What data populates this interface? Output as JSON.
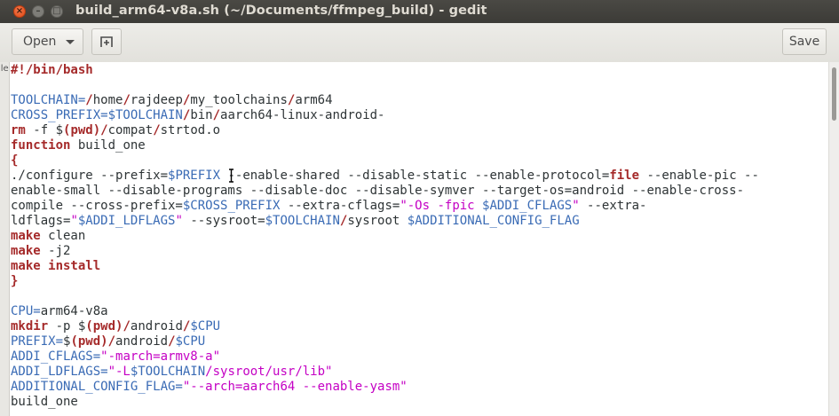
{
  "window": {
    "title": "build_arm64-v8a.sh (~/Documents/ffmpeg_build) - gedit",
    "close_glyph": "×",
    "minimize_glyph": "–",
    "maximize_glyph": "□"
  },
  "toolbar": {
    "open_label": "Open",
    "save_label": "Save",
    "new_tab_icon": "new-tab-icon"
  },
  "side_pane": {
    "text": "ile"
  },
  "colors": {
    "keyword": "#a52a2a",
    "variable": "#3a6bb5",
    "string": "#c400c4",
    "plain": "#2e3436"
  },
  "editor": {
    "lines": [
      [
        {
          "t": "#!/bin/bash",
          "c": "kw"
        }
      ],
      [],
      [
        {
          "t": "TOOLCHAIN=",
          "c": "var"
        },
        {
          "t": "/",
          "c": "kw"
        },
        {
          "t": "home"
        },
        {
          "t": "/",
          "c": "kw"
        },
        {
          "t": "rajdeep"
        },
        {
          "t": "/",
          "c": "kw"
        },
        {
          "t": "my_toolchains"
        },
        {
          "t": "/",
          "c": "kw"
        },
        {
          "t": "arm64"
        }
      ],
      [
        {
          "t": "CROSS_PREFIX=",
          "c": "var"
        },
        {
          "t": "$TOOLCHAIN",
          "c": "var"
        },
        {
          "t": "/",
          "c": "kw"
        },
        {
          "t": "bin"
        },
        {
          "t": "/",
          "c": "kw"
        },
        {
          "t": "aarch64-linux-android-"
        }
      ],
      [
        {
          "t": "rm",
          "c": "kw"
        },
        {
          "t": " -f $"
        },
        {
          "t": "(pwd)",
          "c": "kw"
        },
        {
          "t": "/",
          "c": "kw"
        },
        {
          "t": "compat"
        },
        {
          "t": "/",
          "c": "kw"
        },
        {
          "t": "strtod.o"
        }
      ],
      [
        {
          "t": "function",
          "c": "kw"
        },
        {
          "t": " build_one"
        }
      ],
      [
        {
          "t": "{",
          "c": "kw"
        }
      ],
      [
        {
          "t": "./configure --prefix="
        },
        {
          "t": "$PREFIX",
          "c": "var"
        },
        {
          "t": " --enable-shared --disable-static --enable-protocol="
        },
        {
          "t": "file",
          "c": "kw"
        },
        {
          "t": " --enable-pic --"
        }
      ],
      [
        {
          "t": "enable-small --disable-programs --disable-doc --disable-symver --target-os=android --enable-cross-"
        }
      ],
      [
        {
          "t": "compile --cross-prefix="
        },
        {
          "t": "$CROSS_PREFIX",
          "c": "var"
        },
        {
          "t": " --extra-cflags="
        },
        {
          "t": "\"-Os -fpic ",
          "c": "str"
        },
        {
          "t": "$ADDI_CFLAGS",
          "c": "var"
        },
        {
          "t": "\"",
          "c": "str"
        },
        {
          "t": " --extra-"
        }
      ],
      [
        {
          "t": "ldflags="
        },
        {
          "t": "\"",
          "c": "str"
        },
        {
          "t": "$ADDI_LDFLAGS",
          "c": "var"
        },
        {
          "t": "\"",
          "c": "str"
        },
        {
          "t": " --sysroot="
        },
        {
          "t": "$TOOLCHAIN",
          "c": "var"
        },
        {
          "t": "/",
          "c": "kw"
        },
        {
          "t": "sysroot "
        },
        {
          "t": "$ADDITIONAL_CONFIG_FLAG",
          "c": "var"
        }
      ],
      [
        {
          "t": "make",
          "c": "kw"
        },
        {
          "t": " clean"
        }
      ],
      [
        {
          "t": "make",
          "c": "kw"
        },
        {
          "t": " -j2"
        }
      ],
      [
        {
          "t": "make install",
          "c": "kw"
        }
      ],
      [
        {
          "t": "}",
          "c": "kw"
        }
      ],
      [],
      [
        {
          "t": "CPU=",
          "c": "var"
        },
        {
          "t": "arm64-v8a"
        }
      ],
      [
        {
          "t": "mkdir",
          "c": "kw"
        },
        {
          "t": " -p $"
        },
        {
          "t": "(pwd)",
          "c": "kw"
        },
        {
          "t": "/",
          "c": "kw"
        },
        {
          "t": "android"
        },
        {
          "t": "/",
          "c": "kw"
        },
        {
          "t": "$CPU",
          "c": "var"
        }
      ],
      [
        {
          "t": "PREFIX=",
          "c": "var"
        },
        {
          "t": "$"
        },
        {
          "t": "(pwd)",
          "c": "kw"
        },
        {
          "t": "/",
          "c": "kw"
        },
        {
          "t": "android"
        },
        {
          "t": "/",
          "c": "kw"
        },
        {
          "t": "$CPU",
          "c": "var"
        }
      ],
      [
        {
          "t": "ADDI_CFLAGS=",
          "c": "var"
        },
        {
          "t": "\"-march=armv8-a\"",
          "c": "str"
        }
      ],
      [
        {
          "t": "ADDI_LDFLAGS=",
          "c": "var"
        },
        {
          "t": "\"-L",
          "c": "str"
        },
        {
          "t": "$TOOLCHAIN",
          "c": "var"
        },
        {
          "t": "/sysroot/usr/lib\"",
          "c": "str"
        }
      ],
      [
        {
          "t": "ADDITIONAL_CONFIG_FLAG=",
          "c": "var"
        },
        {
          "t": "\"--arch=aarch64 --enable-yasm\"",
          "c": "str"
        }
      ],
      [
        {
          "t": "build_one"
        }
      ]
    ]
  }
}
